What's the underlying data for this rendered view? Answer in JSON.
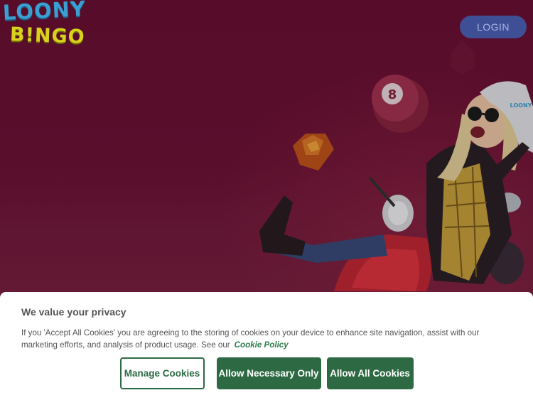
{
  "brand": {
    "logo_top": "LOONY",
    "logo_bottom": "B!NGO",
    "colors": {
      "logo_blue": "#3a9fd1",
      "logo_yellow": "#d9d21c",
      "background": "#6a0f32"
    }
  },
  "header": {
    "login_label": "LOGIN"
  },
  "hero": {
    "bingo_ball_number": "8",
    "helmet_label": "LOONY"
  },
  "cookie_banner": {
    "title": "We value your privacy",
    "body": "If you 'Accept All Cookies' you are agreeing to the storing of cookies on your device to enhance site navigation, assist with our marketing efforts, and analysis of product usage. See our",
    "policy_link": "Cookie Policy",
    "buttons": {
      "manage": "Manage Cookies",
      "necessary": "Allow Necessary Only",
      "all": "Allow All Cookies"
    },
    "colors": {
      "accent": "#2d6a43",
      "text": "#555555"
    }
  }
}
